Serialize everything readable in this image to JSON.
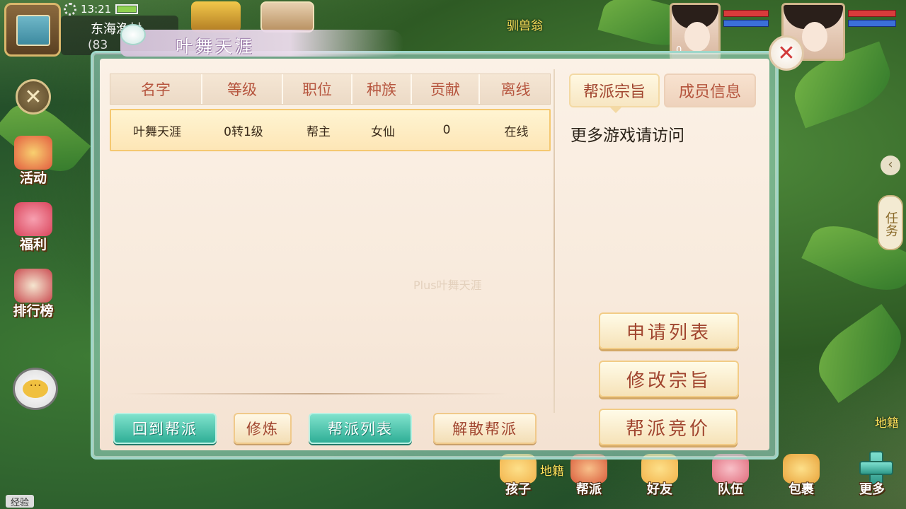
{
  "hud": {
    "time": "13:21",
    "location": "东海渔村",
    "coord": "(83",
    "npc_label": "驯兽翁",
    "player1_level": "0"
  },
  "sidebar": {
    "items": [
      {
        "label": "活动",
        "icon": "horn-icon",
        "color": "#e25b3f"
      },
      {
        "label": "福利",
        "icon": "gift-icon",
        "color": "#d9435a"
      },
      {
        "label": "排行榜",
        "icon": "ranking-icon",
        "color": "#c9484e"
      }
    ],
    "exp_label": "经验"
  },
  "right_side": {
    "task_label": "任务",
    "map_label_right": "地籍",
    "map_label_bottom": "地籍"
  },
  "bottom_menu": [
    {
      "label": "孩子",
      "icon": "child-icon",
      "color": "#f2b24a"
    },
    {
      "label": "帮派",
      "icon": "guild-icon",
      "color": "#d95a3a"
    },
    {
      "label": "好友",
      "icon": "friends-icon",
      "color": "#f2b24a"
    },
    {
      "label": "队伍",
      "icon": "team-icon",
      "color": "#e06a7a"
    },
    {
      "label": "包裹",
      "icon": "bag-icon",
      "color": "#e8a23a"
    },
    {
      "label": "更多",
      "icon": "plus-icon",
      "color": "#3fb8a4"
    }
  ],
  "dialog": {
    "title": "叶舞天涯",
    "table": {
      "headers": [
        "名字",
        "等级",
        "职位",
        "种族",
        "贡献",
        "离线"
      ],
      "rows": [
        [
          "叶舞天涯",
          "0转1级",
          "帮主",
          "女仙",
          "0",
          "在线"
        ]
      ]
    },
    "buttons": {
      "back_to_guild": "回到帮派",
      "cultivate": "修炼",
      "guild_list": "帮派列表",
      "disband": "解散帮派"
    },
    "tabs": {
      "purpose": "帮派宗旨",
      "members_info": "成员信息"
    },
    "purpose_text": "更多游戏请访问",
    "watermark": "Plus叶舞天涯",
    "side_buttons": {
      "apply_list": "申请列表",
      "edit_purpose": "修改宗旨",
      "guild_bid": "帮派竞价"
    }
  },
  "colors": {
    "teal_button": "#2fae96",
    "cream_button": "#f3deb6",
    "header_text": "#b6553e",
    "close_x": "#d23a3a"
  }
}
